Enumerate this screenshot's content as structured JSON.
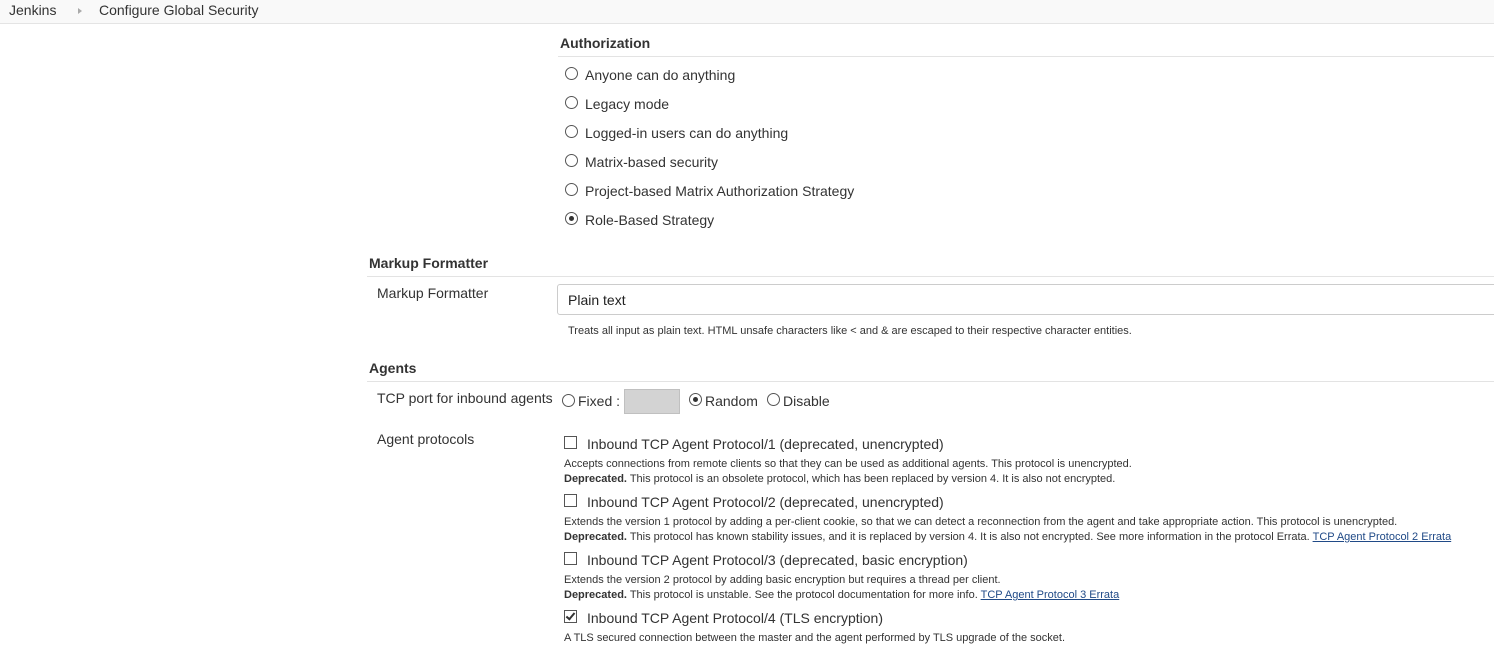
{
  "breadcrumb": {
    "items": [
      "Jenkins",
      "Configure Global Security"
    ]
  },
  "authorization": {
    "title": "Authorization",
    "options": [
      {
        "label": "Anyone can do anything",
        "selected": false
      },
      {
        "label": "Legacy mode",
        "selected": false
      },
      {
        "label": "Logged-in users can do anything",
        "selected": false
      },
      {
        "label": "Matrix-based security",
        "selected": false
      },
      {
        "label": "Project-based Matrix Authorization Strategy",
        "selected": false
      },
      {
        "label": "Role-Based Strategy",
        "selected": true
      }
    ]
  },
  "markup": {
    "title": "Markup Formatter",
    "field_label": "Markup Formatter",
    "selected_value": "Plain text",
    "help": "Treats all input as plain text. HTML unsafe characters like < and & are escaped to their respective character entities."
  },
  "agents": {
    "title": "Agents",
    "tcp_label": "TCP port for inbound agents",
    "tcp_options": {
      "fixed": "Fixed :",
      "random": "Random",
      "disable": "Disable",
      "selected": "Random"
    },
    "protocols_label": "Agent protocols",
    "protocols": [
      {
        "label": "Inbound TCP Agent Protocol/1 (deprecated, unencrypted)",
        "checked": false,
        "desc": "Accepts connections from remote clients so that they can be used as additional agents. This protocol is unencrypted.",
        "deprecated_prefix": "Deprecated.",
        "deprecated_text": " This protocol is an obsolete protocol, which has been replaced by version 4. It is also not encrypted.",
        "link": ""
      },
      {
        "label": "Inbound TCP Agent Protocol/2 (deprecated, unencrypted)",
        "checked": false,
        "desc": "Extends the version 1 protocol by adding a per-client cookie, so that we can detect a reconnection from the agent and take appropriate action. This protocol is unencrypted.",
        "deprecated_prefix": "Deprecated.",
        "deprecated_text": " This protocol has known stability issues, and it is replaced by version 4. It is also not encrypted. See more information in the protocol Errata. ",
        "link": "TCP Agent Protocol 2 Errata"
      },
      {
        "label": "Inbound TCP Agent Protocol/3 (deprecated, basic encryption)",
        "checked": false,
        "desc": "Extends the version 2 protocol by adding basic encryption but requires a thread per client.",
        "deprecated_prefix": "Deprecated.",
        "deprecated_text": " This protocol is unstable. See the protocol documentation for more info. ",
        "link": "TCP Agent Protocol 3 Errata"
      },
      {
        "label": "Inbound TCP Agent Protocol/4 (TLS encryption)",
        "checked": true,
        "desc": "A TLS secured connection between the master and the agent performed by TLS upgrade of the socket."
      }
    ]
  }
}
